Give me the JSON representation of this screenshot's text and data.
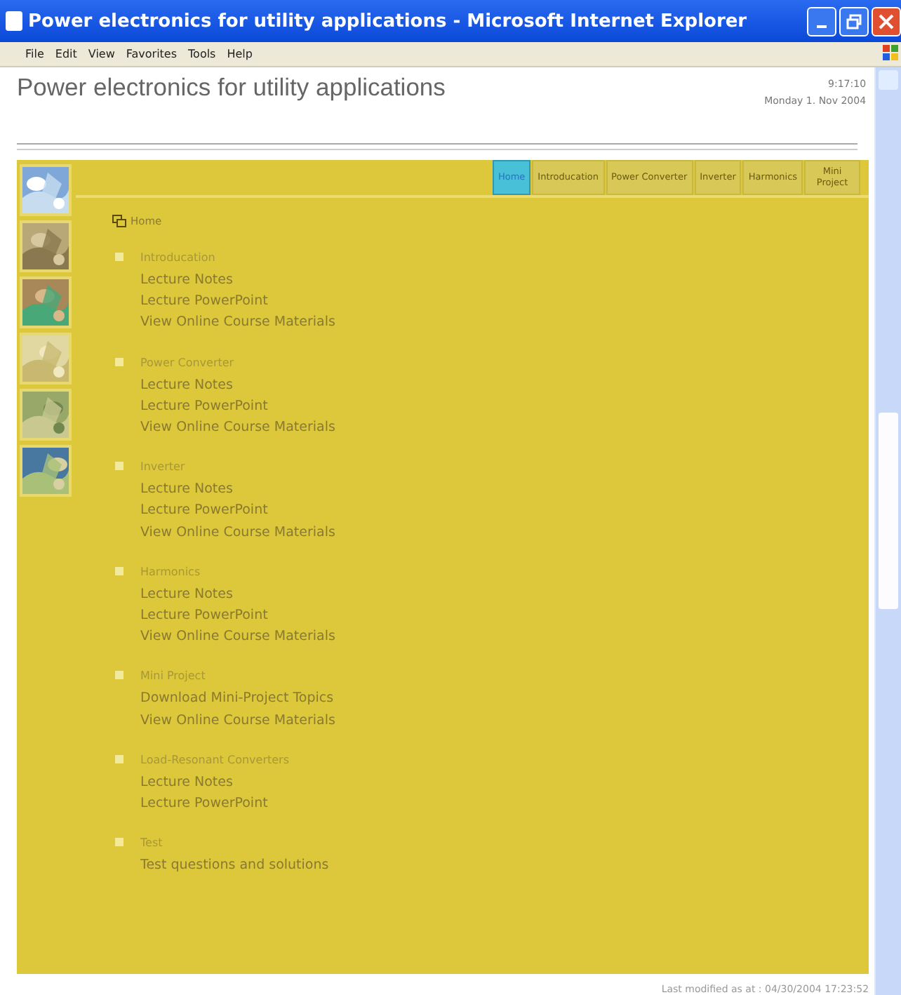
{
  "window": {
    "title": "Power electronics for utility applications - Microsoft Internet Explorer"
  },
  "menu": [
    "File",
    "Edit",
    "View",
    "Favorites",
    "Tools",
    "Help"
  ],
  "header": {
    "title": "Power electronics for utility applications",
    "time": "9:17:10",
    "date": "Monday 1. Nov 2004"
  },
  "thumbnails": [
    {
      "kind": "picture"
    },
    {
      "kind": "picture"
    },
    {
      "kind": "picture"
    },
    {
      "kind": "picture"
    },
    {
      "kind": "picture"
    },
    {
      "kind": "picture"
    }
  ],
  "tabs": [
    {
      "label": "Home",
      "selected": true
    },
    {
      "label": "Introducation",
      "selected": false
    },
    {
      "label": "Power Converter",
      "selected": false
    },
    {
      "label": "Inverter",
      "selected": false
    },
    {
      "label": "Harmonics",
      "selected": false
    },
    {
      "label": "Mini Project",
      "selected": false
    }
  ],
  "breadcrumb": "Home",
  "sections": [
    {
      "title": "Introducation",
      "links": [
        "Lecture Notes",
        "Lecture PowerPoint",
        "View Online Course Materials"
      ]
    },
    {
      "title": "Power Converter",
      "links": [
        "Lecture Notes",
        "Lecture PowerPoint",
        "View Online Course Materials"
      ]
    },
    {
      "title": "Inverter",
      "links": [
        "Lecture Notes",
        "Lecture PowerPoint",
        "View Online Course Materials"
      ]
    },
    {
      "title": "Harmonics",
      "links": [
        "Lecture Notes",
        "Lecture PowerPoint",
        "View Online Course Materials"
      ]
    },
    {
      "title": "Mini Project",
      "links": [
        "Download Mini-Project Topics",
        "View Online Course Materials"
      ]
    },
    {
      "title": "Load-Resonant Converters",
      "links": [
        "Lecture Notes",
        "Lecture PowerPoint"
      ]
    },
    {
      "title": "Test",
      "links": [
        "Test questions and solutions"
      ]
    }
  ],
  "footer": "Last modified as at : 04/30/2004 17:23:52"
}
